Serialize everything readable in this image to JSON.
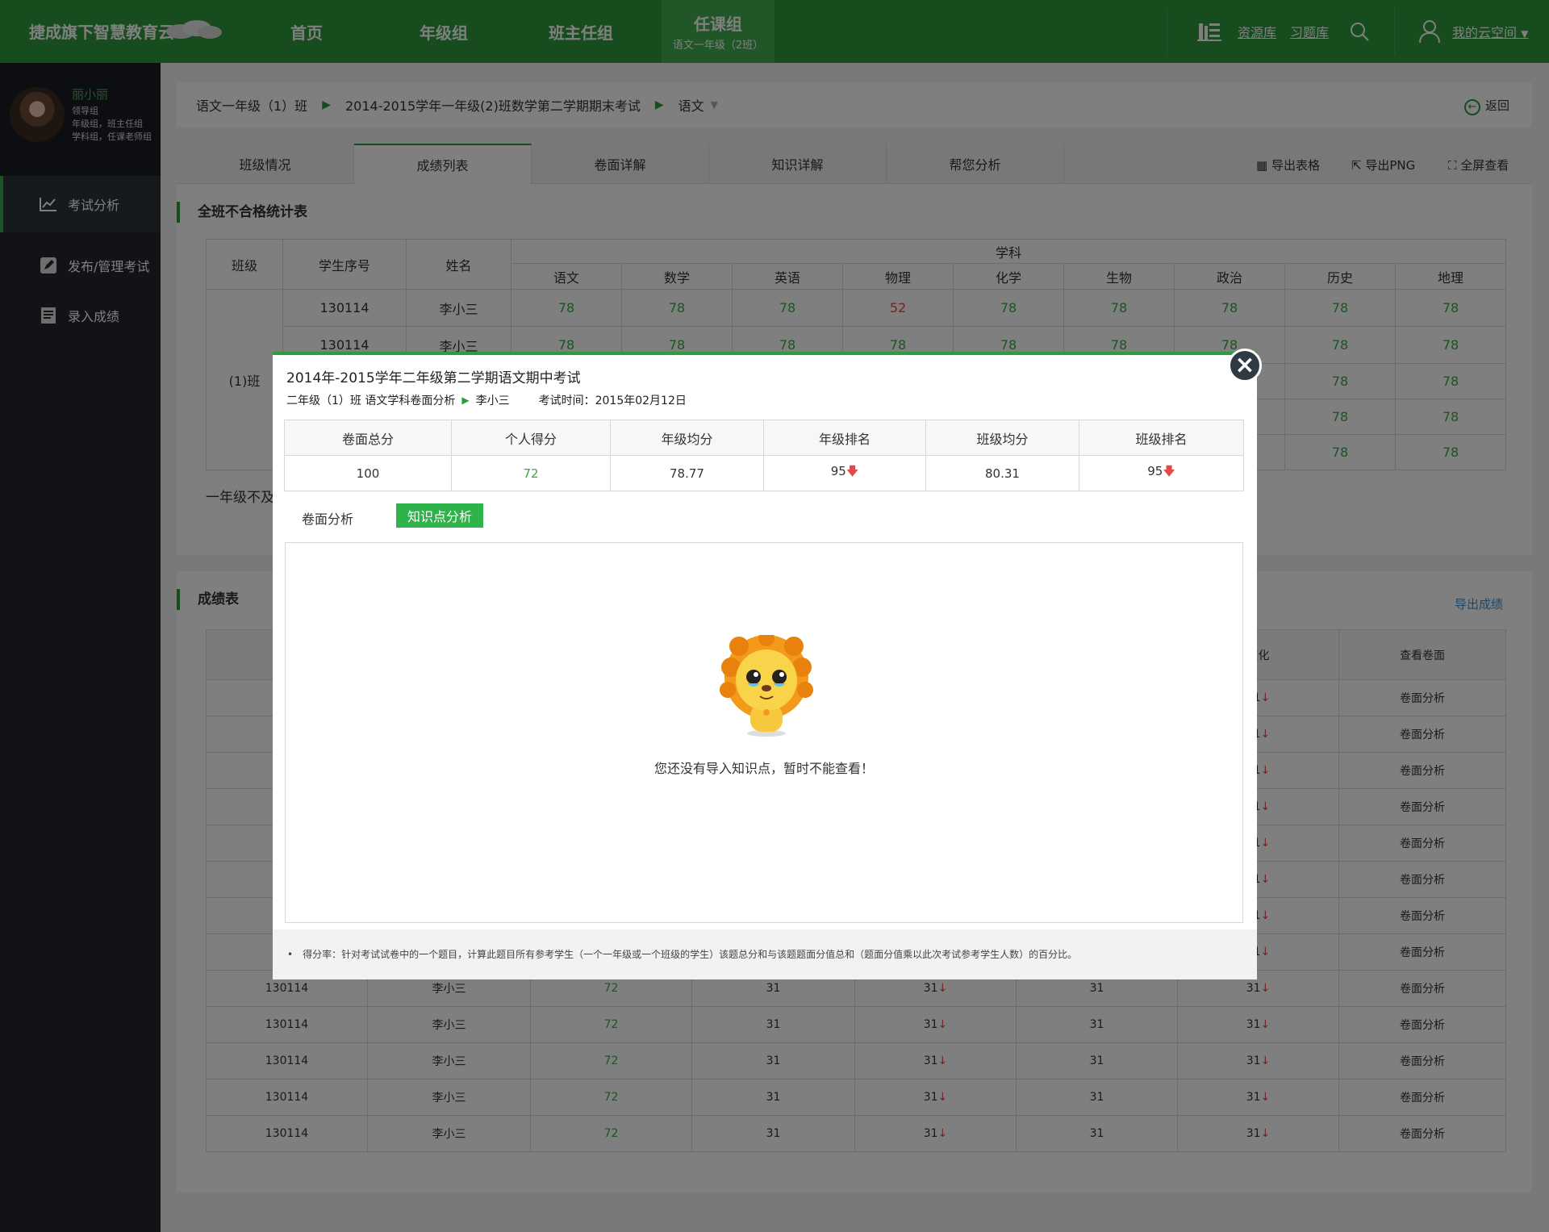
{
  "app": {
    "logo": "捷成旗下智慧教育云"
  },
  "nav": [
    {
      "label": "首页"
    },
    {
      "label": "年级组"
    },
    {
      "label": "班主任组"
    },
    {
      "label": "任课组",
      "sub": "语文一年级（2班）"
    }
  ],
  "top_links": {
    "resources": "资源库",
    "questions": "习题库",
    "my_space": "我的云空间"
  },
  "profile": {
    "name": "丽小丽",
    "info": [
      "领导组",
      "年级组，班主任组",
      "学科组，任课老师组"
    ]
  },
  "sidebar": [
    {
      "label": "考试分析"
    },
    {
      "label": "发布/管理考试"
    },
    {
      "label": "录入成绩"
    }
  ],
  "breadcrumb": {
    "class": "语文一年级（1）班",
    "exam": "2014-2015学年一年级(2)班数学第二学期期末考试",
    "subject": "语文",
    "back": "返回"
  },
  "tabs": [
    "班级情况",
    "成绩列表",
    "卷面详解",
    "知识详解",
    "帮您分析"
  ],
  "tools": {
    "export_table": "导出表格",
    "export_png": "导出PNG",
    "fullscreen": "全屏查看"
  },
  "fail_section": {
    "title": "全班不合格统计表",
    "headers": {
      "class": "班级",
      "student_no": "学生序号",
      "name": "姓名",
      "subjects_group": "学科"
    },
    "subjects": [
      "语文",
      "数学",
      "英语",
      "物理",
      "化学",
      "生物",
      "政治",
      "历史",
      "地理"
    ],
    "class_label": "(1)班",
    "rows": [
      {
        "no": "130114",
        "name": "李小三",
        "scores": [
          "78",
          "78",
          "78",
          "52",
          "78",
          "78",
          "78",
          "78",
          "78"
        ]
      },
      {
        "no": "130114",
        "name": "李小三",
        "scores": [
          "78",
          "78",
          "78",
          "78",
          "78",
          "78",
          "78",
          "78",
          "78"
        ]
      },
      {
        "scores_right": [
          "78",
          "78"
        ]
      },
      {
        "scores_right": [
          "78",
          "78"
        ]
      },
      {
        "scores_right": [
          "78",
          "78"
        ]
      }
    ],
    "note": "一年级不及"
  },
  "score_section": {
    "title": "成绩表",
    "export": "导出成绩",
    "headers": {
      "change": "变化",
      "view": "查看卷面"
    },
    "view_label": "卷面分析",
    "partial_rows": [
      "31",
      "31",
      "31",
      "31",
      "31",
      "31",
      "31",
      "31"
    ],
    "rows": [
      {
        "no": "130114",
        "name": "李小三",
        "score": "72",
        "a": "31",
        "b": "31",
        "c": "31",
        "d": "31"
      },
      {
        "no": "130114",
        "name": "李小三",
        "score": "72",
        "a": "31",
        "b": "31",
        "c": "31",
        "d": "31"
      },
      {
        "no": "130114",
        "name": "李小三",
        "score": "72",
        "a": "31",
        "b": "31",
        "c": "31",
        "d": "31"
      },
      {
        "no": "130114",
        "name": "李小三",
        "score": "72",
        "a": "31",
        "b": "31",
        "c": "31",
        "d": "31"
      },
      {
        "no": "130114",
        "name": "李小三",
        "score": "72",
        "a": "31",
        "b": "31",
        "c": "31",
        "d": "31"
      }
    ]
  },
  "modal": {
    "title": "2014年-2015学年二年级第二学期语文期中考试",
    "sub_class": "二年级（1）班  语文学科卷面分析",
    "student": "李小三",
    "exam_time": "考试时间：2015年02月12日",
    "stats_headers": [
      "卷面总分",
      "个人得分",
      "年级均分",
      "年级排名",
      "班级均分",
      "班级排名"
    ],
    "stats_values": [
      "100",
      "72",
      "78.77",
      "95",
      "80.31",
      "95"
    ],
    "tab_paper": "卷面分析",
    "tab_knowledge": "知识点分析",
    "empty_message": "您还没有导入知识点，暂时不能查看！",
    "footnote": "得分率：针对考试试卷中的一个题目，计算此题目所有参考学生（一个一年级或一个班级的学生）该题总分和与该题题面分值总和（题面分值乘以此次考试参考学生人数）的百分比。",
    "close": "×"
  },
  "colors": {
    "brand": "#2e9b3c",
    "accent": "#2eb24a",
    "down": "#e04a4a"
  }
}
